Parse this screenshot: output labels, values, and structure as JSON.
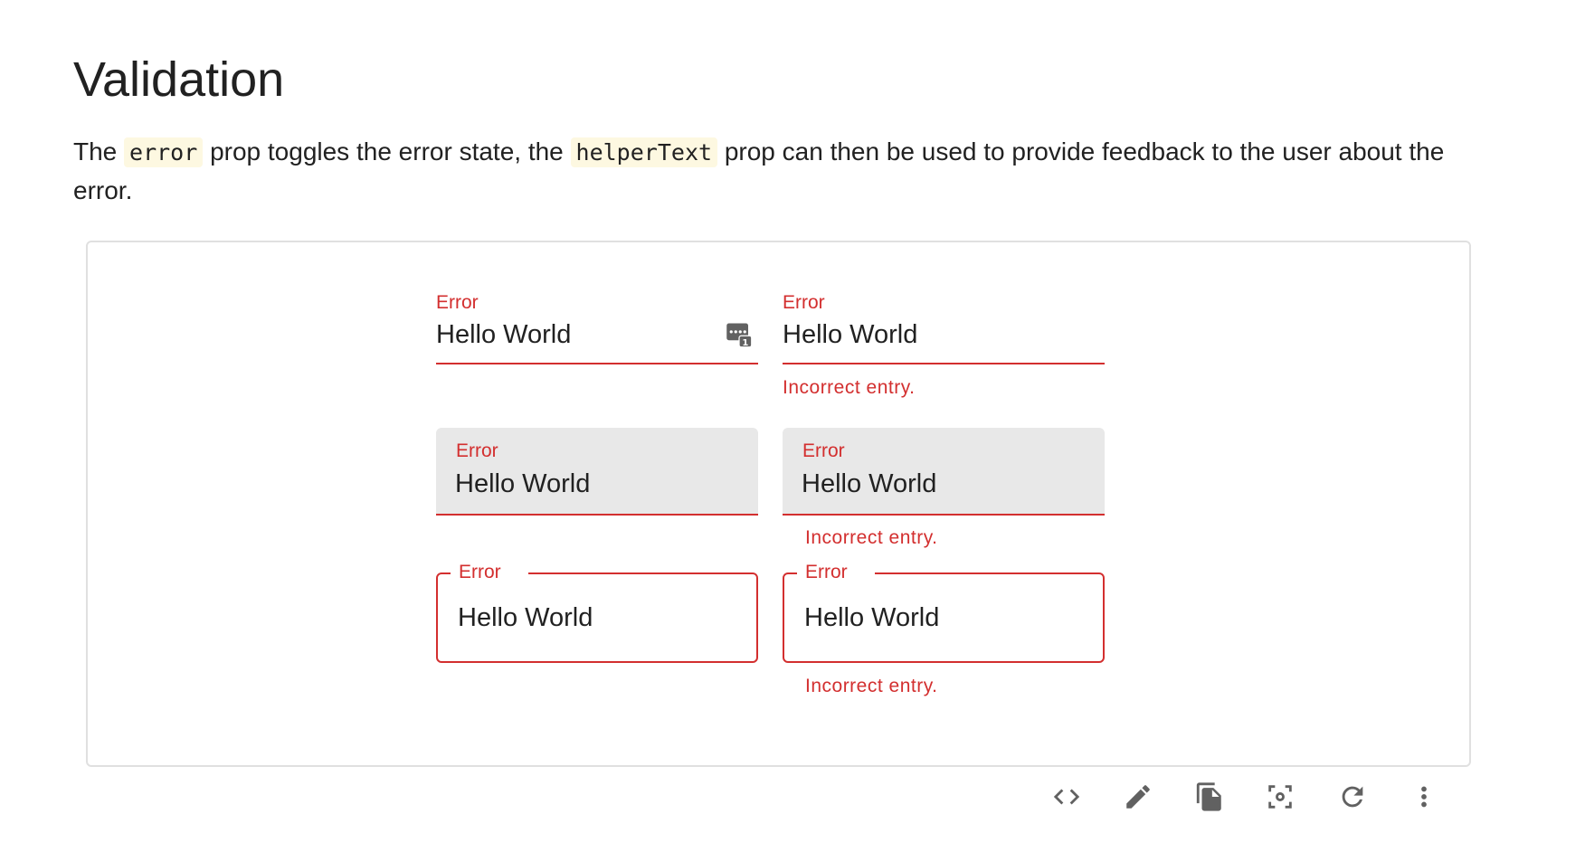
{
  "page": {
    "title": "Validation",
    "description": {
      "part1": "The ",
      "code1": "error",
      "part2": " prop toggles the error state, the ",
      "code2": "helperText",
      "part3": " prop can then be used to provide feedback to the user about the error."
    }
  },
  "demo": {
    "standard": [
      {
        "label": "Error",
        "value": "Hello World",
        "helper": "",
        "adornment_icon": "password-manager-icon"
      },
      {
        "label": "Error",
        "value": "Hello World",
        "helper": "Incorrect entry."
      }
    ],
    "filled": [
      {
        "label": "Error",
        "value": "Hello World",
        "helper": ""
      },
      {
        "label": "Error",
        "value": "Hello World",
        "helper": "Incorrect entry."
      }
    ],
    "outlined": [
      {
        "label": "Error",
        "value": "Hello World",
        "helper": ""
      },
      {
        "label": "Error",
        "value": "Hello World",
        "helper": "Incorrect entry."
      }
    ]
  },
  "toolbar": {
    "icons": [
      "code-icon",
      "edit-icon",
      "copy-icon",
      "screenshot-icon",
      "reset-icon",
      "more-vert-icon"
    ]
  },
  "colors": {
    "error": "#d32f2f",
    "text": "#212121",
    "filled_background": "#e8e8e8",
    "code_background": "#fdf8e1",
    "icon": "#616161"
  }
}
